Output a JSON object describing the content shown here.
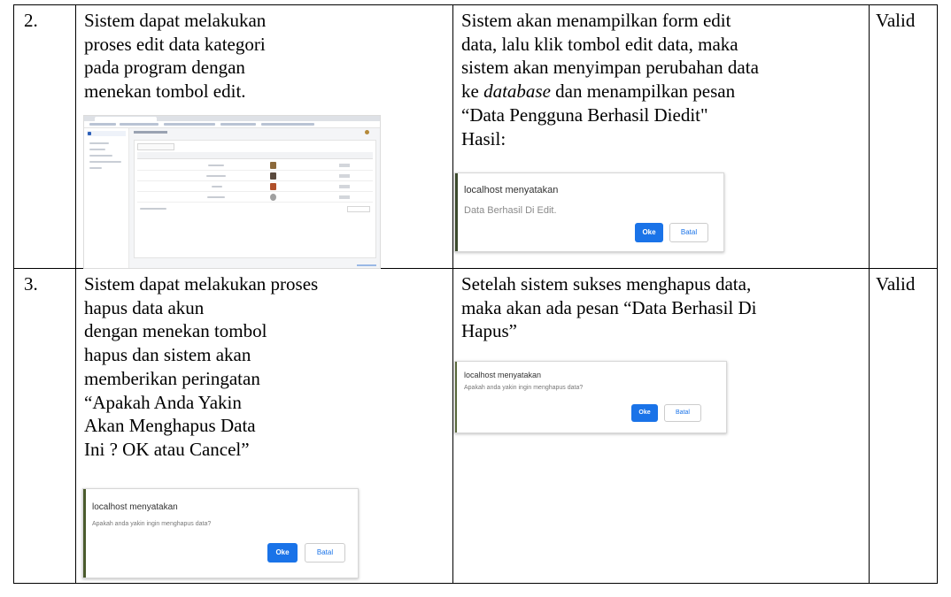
{
  "rows": [
    {
      "number": "2.",
      "statement_lines": [
        "Sistem dapat melakukan",
        "proses edit data kategori",
        "pada program dengan",
        "menekan tombol edit."
      ],
      "result_lines": [
        "Sistem akan menampilkan form edit",
        "data, lalu klik tombol edit data, maka",
        "sistem akan menyimpan perubahan data",
        "ke",
        "database",
        "dan menampilkan pesan",
        "“Data Pengguna Berhasil Diedit\"",
        "Hasil:"
      ],
      "dialog": {
        "title": "localhost menyatakan",
        "message": "Data Berhasil Di Edit.",
        "ok_label": "Oke",
        "cancel_label": "Batal"
      },
      "status": "Valid"
    },
    {
      "number": "3.",
      "statement_lines": [
        "Sistem dapat melakukan proses",
        "hapus data akun",
        "dengan menekan tombol",
        "hapus dan sistem akan",
        "memberikan peringatan",
        "“Apakah Anda Yakin",
        "Akan Menghapus Data",
        "Ini ? OK atau Cancel”"
      ],
      "dialog": {
        "title": "localhost menyatakan",
        "message": "Apakah anda yakin ingin menghapus data?",
        "ok_label": "Oke",
        "cancel_label": "Batal"
      },
      "result_lines": [
        "Setelah sistem sukses menghapus data,",
        "maka akan ada pesan “Data Berhasil Di",
        "Hapus”"
      ],
      "result_dialog": {
        "title": "localhost menyatakan",
        "message": "Apakah anda yakin ingin menghapus data?",
        "ok_label": "Oke",
        "cancel_label": "Batal"
      },
      "status": "Valid"
    }
  ],
  "colors": {
    "ok_button": "#1a73e8",
    "dialog_accent": "#3c4a2c",
    "text": "#000000"
  }
}
